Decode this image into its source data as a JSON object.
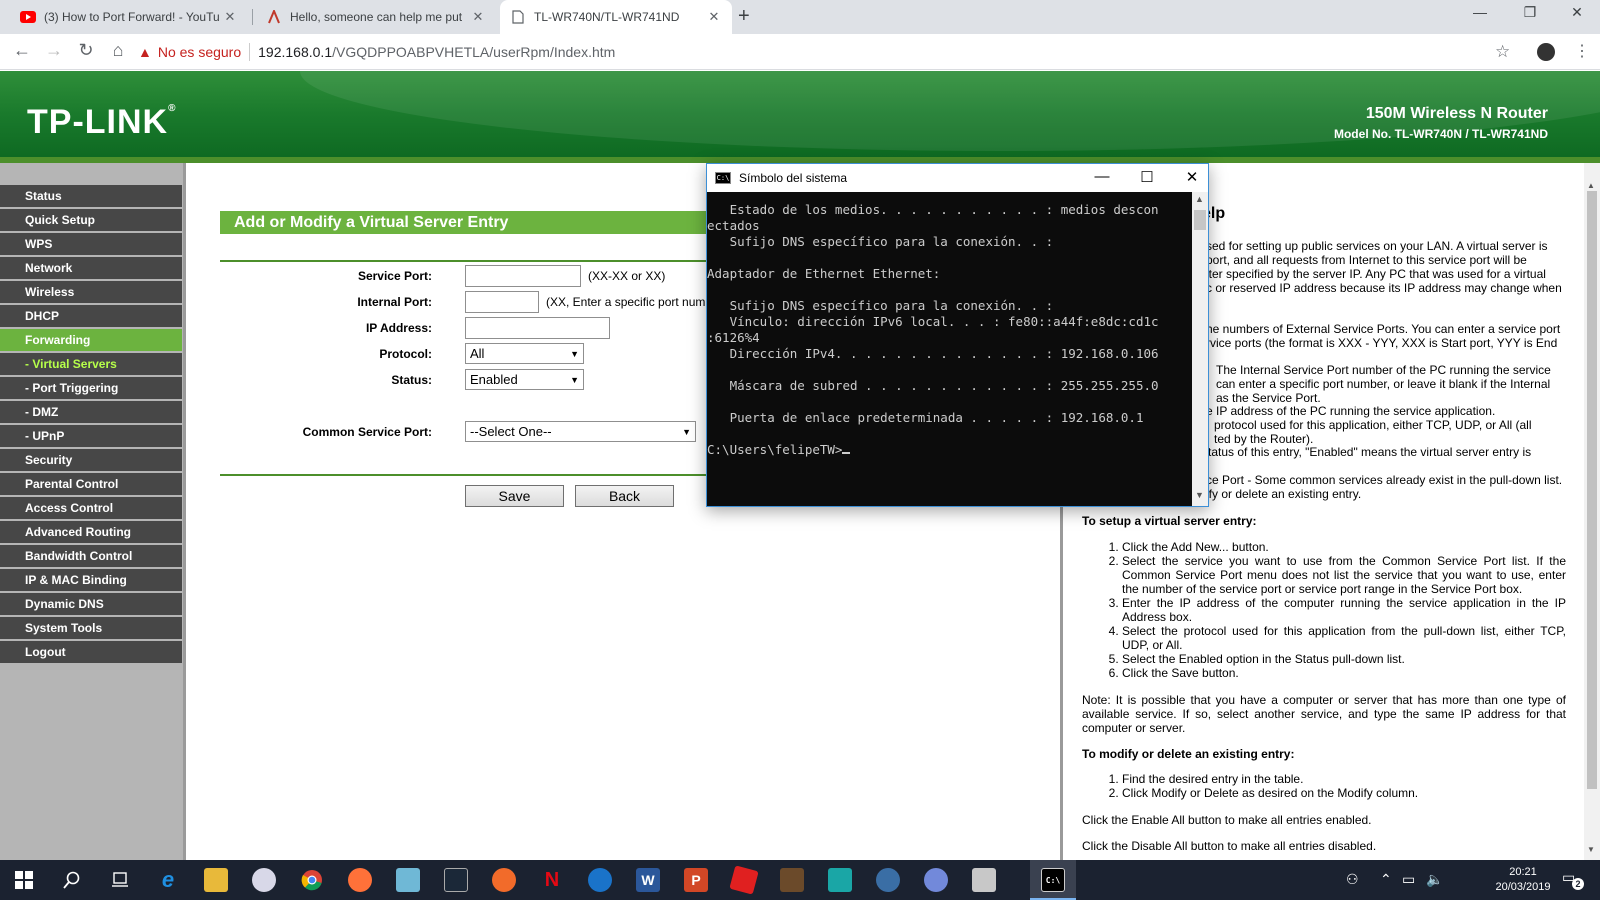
{
  "browser": {
    "tabs": [
      {
        "title": "(3) How to Port Forward! - YouTu",
        "icon": "youtube-icon",
        "active": false
      },
      {
        "title": "Hello, someone can help me put",
        "icon": "forum-icon",
        "active": false
      },
      {
        "title": "TL-WR740N/TL-WR741ND",
        "icon": "page-icon",
        "active": true
      }
    ],
    "security_label": "No es seguro",
    "url_host": "192.168.0.1",
    "url_path": "/VGQDPPOABPVHETLA/userRpm/Index.htm"
  },
  "header": {
    "logo": "TP-LINK",
    "product": "150M Wireless N Router",
    "model": "Model No. TL-WR740N / TL-WR741ND"
  },
  "sidebar": {
    "items": [
      {
        "label": "Status"
      },
      {
        "label": "Quick Setup"
      },
      {
        "label": "WPS"
      },
      {
        "label": "Network"
      },
      {
        "label": "Wireless"
      },
      {
        "label": "DHCP"
      },
      {
        "label": "Forwarding"
      },
      {
        "label": "- Virtual Servers"
      },
      {
        "label": "- Port Triggering"
      },
      {
        "label": "- DMZ"
      },
      {
        "label": "- UPnP"
      },
      {
        "label": "Security"
      },
      {
        "label": "Parental Control"
      },
      {
        "label": "Access Control"
      },
      {
        "label": "Advanced Routing"
      },
      {
        "label": "Bandwidth Control"
      },
      {
        "label": "IP & MAC Binding"
      },
      {
        "label": "Dynamic DNS"
      },
      {
        "label": "System Tools"
      },
      {
        "label": "Logout"
      }
    ]
  },
  "form": {
    "title": "Add or Modify a Virtual Server Entry",
    "service_port_label": "Service Port:",
    "service_port_value": "",
    "service_port_hint": "(XX-XX or XX)",
    "internal_port_label": "Internal Port:",
    "internal_port_value": "",
    "internal_port_hint": "(XX, Enter a specific port num",
    "ip_label": "IP Address:",
    "ip_value": "",
    "protocol_label": "Protocol:",
    "protocol_value": "All",
    "status_label": "Status:",
    "status_value": "Enabled",
    "common_label": "Common Service Port:",
    "common_value": "--Select One--",
    "save": "Save",
    "back": "Back"
  },
  "help": {
    "title": "elp",
    "p1": "sed for setting up public services on your LAN. A virtual server is\nport, and all requests from Internet to this service port will be\niter specified by the server IP. Any PC that was used for a virtual\nc or reserved IP address because its IP address may change when",
    "p2": "he numbers of External Service Ports. You can enter a service port\nrvice ports (the format is XXX - YYY, XXX is Start port, YYY is End",
    "p3a": "The Internal Service Port number of the PC running the service\ncan enter a specific port number, or leave it blank if the Internal\nas the Service Port.",
    "p3b": "e IP address of the PC running the service application.",
    "p3c": "protocol used for this application, either TCP, UDP, or All (all\nted by the Router).",
    "p3d": "tatus of this entry, \"Enabled\" means the virtual server entry is",
    "p3e": "ce Port - Some common services already exist in the pull-down list.\nify or delete an existing entry.",
    "setup_title": "To setup a virtual server entry:",
    "setup_steps": [
      "Click the Add New... button.",
      "Select the service you want to use from the Common Service Port list. If the Common Service Port menu does not list the service that you want to use, enter the number of the service port or service port range in the Service Port box.",
      "Enter the IP address of the computer running the service application in the IP Address box.",
      "Select the protocol used for this application from the pull-down list, either TCP, UDP, or All.",
      "Select the Enabled option in the Status pull-down list.",
      "Click the Save button."
    ],
    "note": "Note: It is possible that you have a computer or server that has more than one type of available service. If so, select another service, and type the same IP address for that computer or server.",
    "modify_title": "To modify or delete an existing entry:",
    "modify_steps": [
      "Find the desired entry in the table.",
      "Click Modify or Delete as desired on the Modify column."
    ],
    "enable_all": "Click the Enable All button to make all entries enabled.",
    "disable_all": "Click the Disable All button to make all entries disabled."
  },
  "cmd": {
    "title": "Símbolo del sistema",
    "output": "   Estado de los medios. . . . . . . . . . . : medios descon\nectados\n   Sufijo DNS específico para la conexión. . :\n\nAdaptador de Ethernet Ethernet:\n\n   Sufijo DNS específico para la conexión. . :\n   Vínculo: dirección IPv6 local. . . : fe80::a44f:e8dc:cd1c\n:6126%4\n   Dirección IPv4. . . . . . . . . . . . . . : 192.168.0.106\n\n   Máscara de subred . . . . . . . . . . . . : 255.255.255.0\n\n   Puerta de enlace predeterminada . . . . . : 192.168.0.1\n\nC:\\Users\\felipeTW>"
  },
  "taskbar": {
    "time": "20:21",
    "date": "20/03/2019",
    "notification_count": "2"
  }
}
